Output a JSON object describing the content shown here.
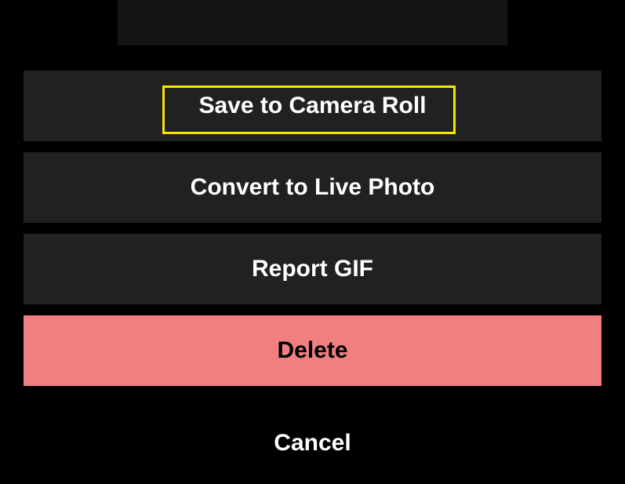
{
  "actions": {
    "save": "Save to Camera Roll",
    "convert": "Convert to Live Photo",
    "report": "Report GIF",
    "delete": "Delete",
    "cancel": "Cancel"
  }
}
